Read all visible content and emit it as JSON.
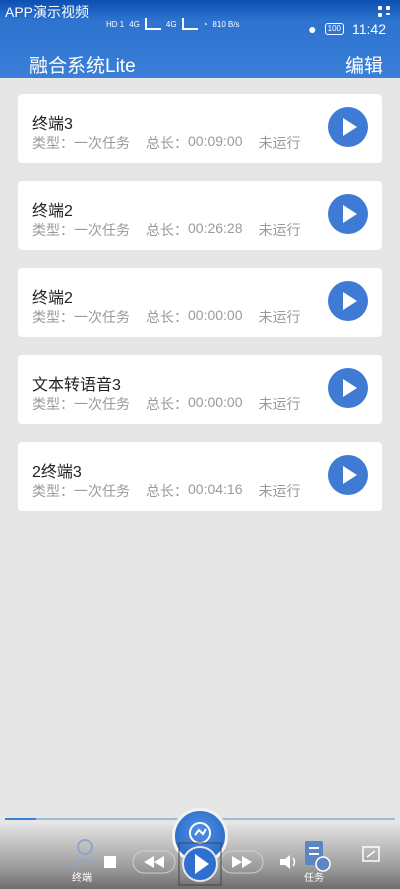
{
  "overlay": {
    "title": "APP演示视频"
  },
  "status_bar": {
    "hd1": "HD 1",
    "hd2": "HD 2",
    "net1": "4G",
    "net2": "4G",
    "speed": "810 B/s",
    "battery": "100",
    "time": "11:42"
  },
  "header": {
    "title": "融合系统Lite",
    "edit_label": "编辑"
  },
  "labels": {
    "type_prefix": "类型：",
    "duration_prefix": "总长："
  },
  "tasks": [
    {
      "name": "终端3",
      "type": "一次任务",
      "duration": "00:09:00",
      "status": "未运行"
    },
    {
      "name": "终端2",
      "type": "一次任务",
      "duration": "00:26:28",
      "status": "未运行"
    },
    {
      "name": "终端2",
      "type": "一次任务",
      "duration": "00:00:00",
      "status": "未运行"
    },
    {
      "name": "文本转语音3",
      "type": "一次任务",
      "duration": "00:00:00",
      "status": "未运行"
    },
    {
      "name": "2终端3",
      "type": "一次任务",
      "duration": "00:04:16",
      "status": "未运行"
    }
  ],
  "bottom_nav": {
    "left_label": "终端",
    "right_label": "任务"
  },
  "player": {
    "progress": 0.08
  },
  "colors": {
    "header": "#3a7fd8",
    "play_button": "#3f7bd4",
    "background": "#e6e6e6",
    "meta_text": "#9a9a9a"
  }
}
